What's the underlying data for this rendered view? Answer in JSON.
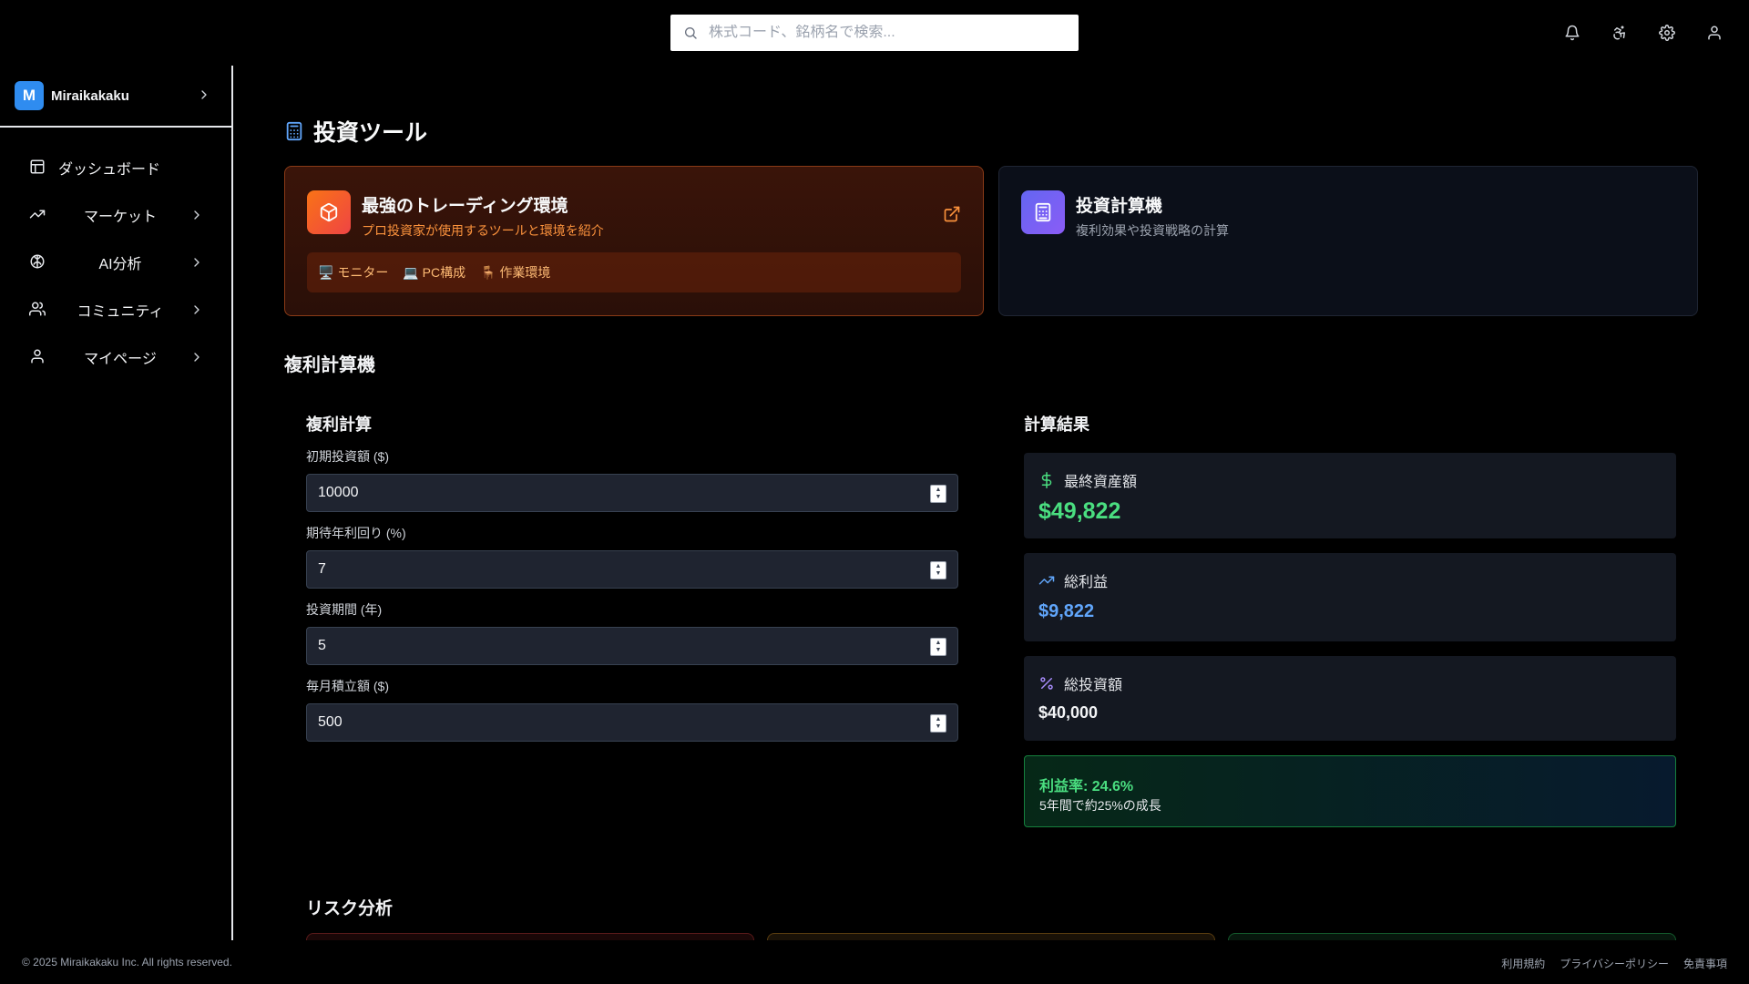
{
  "search": {
    "placeholder": "株式コード、銘柄名で検索..."
  },
  "header_icons": [
    "bell-icon",
    "accessibility-icon",
    "gear-icon",
    "user-icon"
  ],
  "sidebar": {
    "brand": {
      "logo_letter": "M",
      "name": "Miraikakaku"
    },
    "items": [
      {
        "label": "ダッシュボード",
        "icon": "layout-icon",
        "has_chevron": false
      },
      {
        "label": "マーケット",
        "icon": "trending-up-icon",
        "has_chevron": true
      },
      {
        "label": "AI分析",
        "icon": "brain-icon",
        "has_chevron": true
      },
      {
        "label": "コミュニティ",
        "icon": "users-icon",
        "has_chevron": true
      },
      {
        "label": "マイページ",
        "icon": "user-icon",
        "has_chevron": true
      }
    ]
  },
  "page": {
    "title": "投資ツール"
  },
  "cards": {
    "trading": {
      "title": "最強のトレーディング環境",
      "subtitle": "プロ投資家が使用するツールと環境を紹介",
      "tags": [
        "🖥️ モニター",
        "💻 PC構成",
        "🪑 作業環境"
      ]
    },
    "calculator": {
      "title": "投資計算機",
      "subtitle": "複利効果や投資戦略の計算"
    }
  },
  "compound": {
    "section_title": "複利計算機",
    "form_title": "複利計算",
    "fields": [
      {
        "label": "初期投資額 ($)",
        "value": "10000"
      },
      {
        "label": "期待年利回り (%)",
        "value": "7"
      },
      {
        "label": "投資期間 (年)",
        "value": "5"
      },
      {
        "label": "毎月積立額 ($)",
        "value": "500"
      }
    ],
    "results_title": "計算結果",
    "results": {
      "final": {
        "label": "最終資産額",
        "value": "$49,822"
      },
      "profit": {
        "label": "総利益",
        "value": "$9,822"
      },
      "invested": {
        "label": "総投資額",
        "value": "$40,000"
      }
    },
    "rate": {
      "main": "利益率: 24.6%",
      "sub": "5年間で約25%の成長"
    }
  },
  "risk": {
    "title": "リスク分析"
  },
  "footer": {
    "copyright": "© 2025 Miraikakaku Inc. All rights reserved.",
    "links": [
      "利用規約",
      "プライバシーポリシー",
      "免責事項"
    ]
  },
  "colors": {
    "accent_blue": "#2f8cf0",
    "profit_green": "#4ade80",
    "profit_blue": "#60a5fa",
    "orange": "#fb923c"
  }
}
